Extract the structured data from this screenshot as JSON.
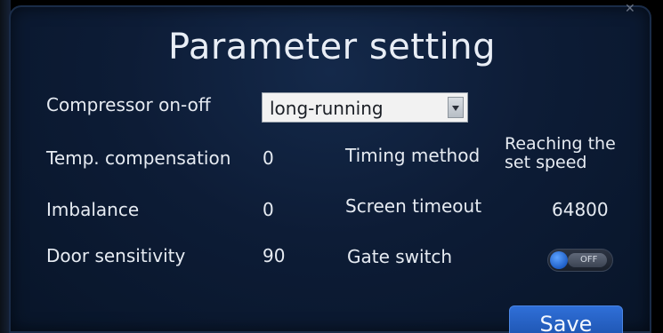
{
  "header": {
    "title": "Parameter setting"
  },
  "settings": {
    "compressor": {
      "label": "Compressor on-off",
      "selected": "long-running"
    },
    "temp_compensation": {
      "label": "Temp. compensation",
      "value": "0"
    },
    "imbalance": {
      "label": "Imbalance",
      "value": "0"
    },
    "door_sensitivity": {
      "label": "Door sensitivity",
      "value": "90"
    },
    "timing_method": {
      "label": "Timing method",
      "value_line1": "Reaching the",
      "value_line2": "set speed"
    },
    "screen_timeout": {
      "label": "Screen timeout",
      "value": "64800"
    },
    "gate_switch": {
      "label": "Gate switch",
      "state": "OFF"
    }
  },
  "actions": {
    "save_label": "Save"
  },
  "colors": {
    "panel_bg": "#0d1c36",
    "text": "#e6ebf2",
    "accent": "#2f6fd8"
  }
}
